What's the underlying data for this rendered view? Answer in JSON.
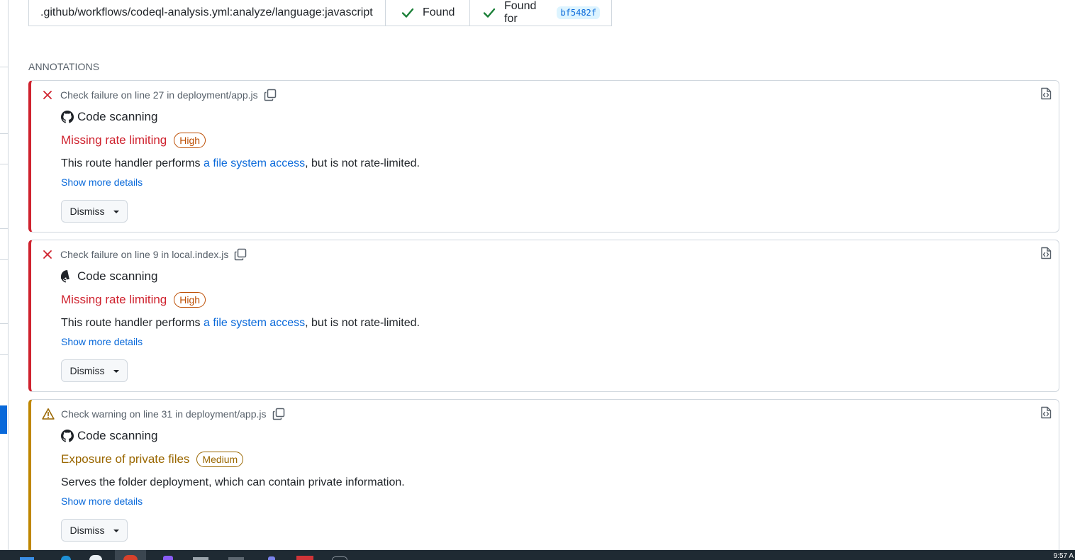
{
  "summary": {
    "path": ".github/workflows/codeql-analysis.yml:analyze/language:javascript",
    "found_label": "Found",
    "found_for_label": "Found for",
    "commit_sha": "bf5482f"
  },
  "annotations_heading": "ANNOTATIONS",
  "annotations": [
    {
      "kind": "failure",
      "header": "Check failure on line 27 in deployment/app.js",
      "tool": "Code scanning",
      "rule": "Missing rate limiting",
      "severity": "High",
      "message_prefix": "This route handler performs ",
      "message_link": "a file system access",
      "message_suffix": ", but is not rate-limited.",
      "more_link": "Show more details",
      "dismiss_label": "Dismiss"
    },
    {
      "kind": "failure",
      "header": "Check failure on line 9 in local.index.js",
      "tool": "Code scanning",
      "rule": "Missing rate limiting",
      "severity": "High",
      "message_prefix": "This route handler performs ",
      "message_link": "a file system access",
      "message_suffix": ", but is not rate-limited.",
      "more_link": "Show more details",
      "dismiss_label": "Dismiss"
    },
    {
      "kind": "warning",
      "header": "Check warning on line 31 in deployment/app.js",
      "tool": "Code scanning",
      "rule": "Exposure of private files",
      "severity": "Medium",
      "message": "Serves the folder deployment, which can contain private information.",
      "more_link": "Show more details",
      "dismiss_label": "Dismiss"
    }
  ],
  "taskbar": {
    "clock": "9:57 A"
  },
  "colors": {
    "failure": "#cf222e",
    "warning": "#bf8700",
    "link": "#0969da",
    "success": "#1a7f37"
  },
  "icons": {
    "found": "check-icon",
    "failure": "x-icon",
    "warning": "alert-icon",
    "copy": "copy-icon",
    "view_file": "file-code-icon",
    "tool": "github-mark-icon",
    "dismiss": "triangle-down-icon"
  }
}
